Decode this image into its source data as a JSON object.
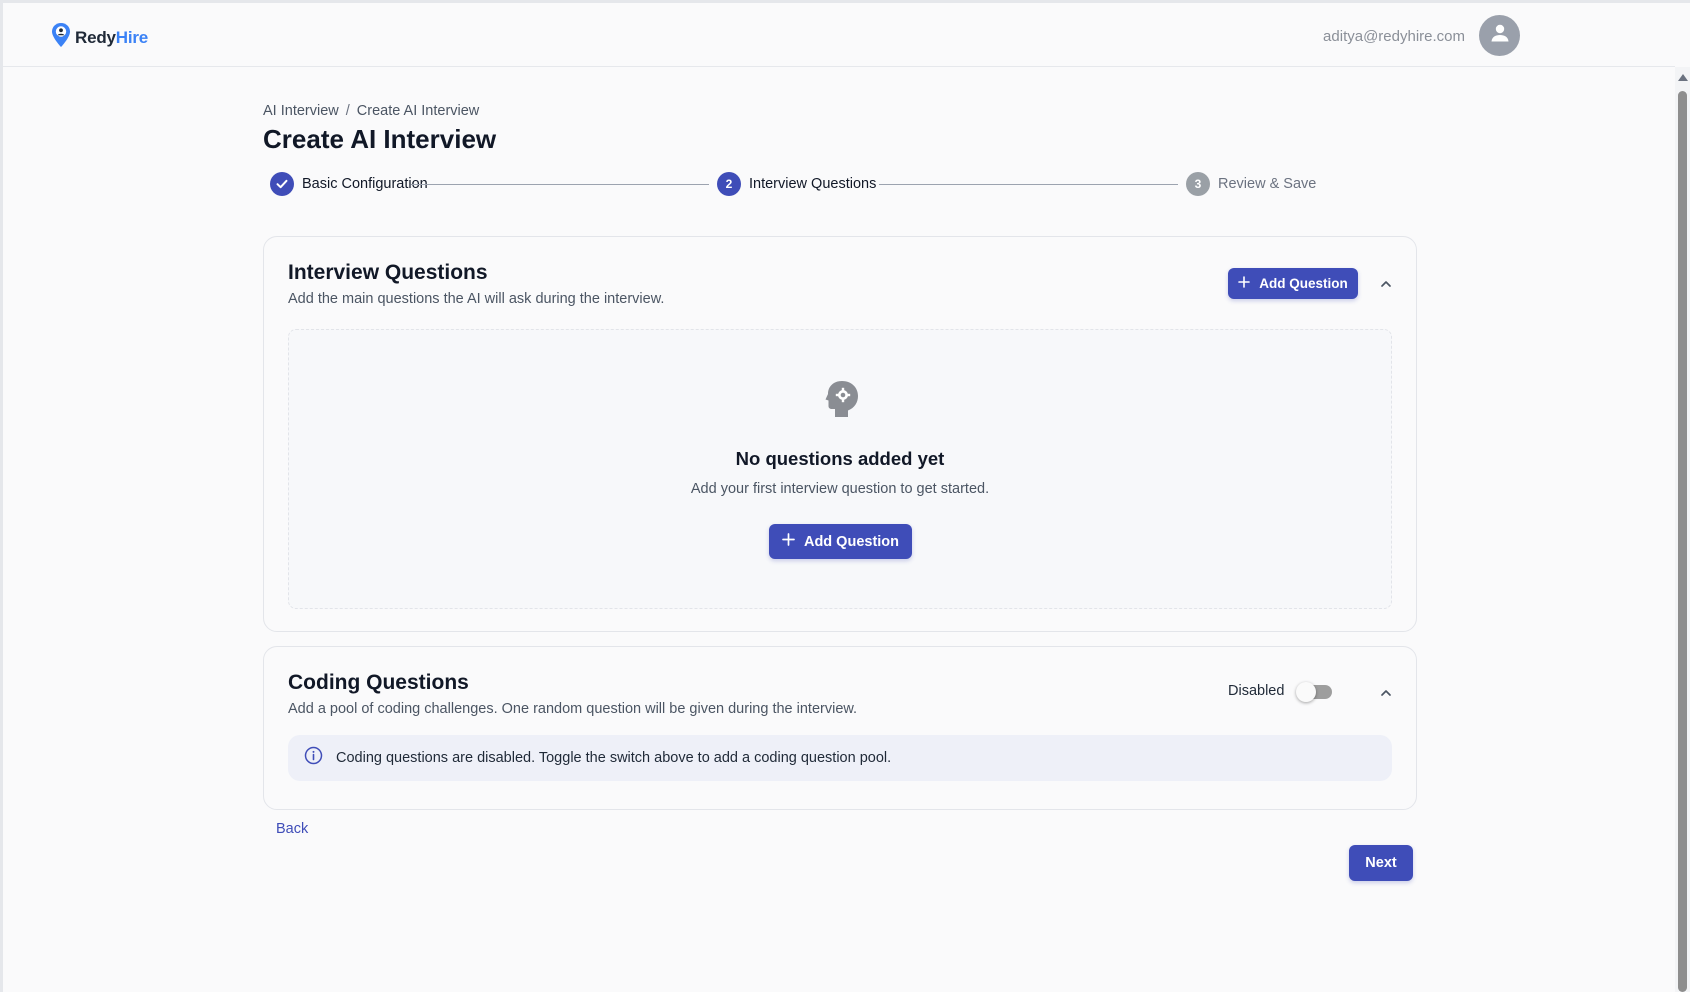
{
  "header": {
    "logo_part1": "Redy",
    "logo_part2": "Hire",
    "user_email": "aditya@redyhire.com"
  },
  "breadcrumb": {
    "items": [
      "AI Interview",
      "Create AI Interview"
    ],
    "separator": "/"
  },
  "page_title": "Create AI Interview",
  "stepper": {
    "steps": [
      {
        "label": "Basic Configuration",
        "state": "completed",
        "number": "1"
      },
      {
        "label": "Interview Questions",
        "state": "active",
        "number": "2"
      },
      {
        "label": "Review & Save",
        "state": "pending",
        "number": "3"
      }
    ]
  },
  "interview_section": {
    "title": "Interview Questions",
    "subtitle": "Add the main questions the AI will ask during the interview.",
    "add_button": "Add Question",
    "empty_title": "No questions added yet",
    "empty_subtitle": "Add your first interview question to get started.",
    "empty_button": "Add Question"
  },
  "coding_section": {
    "title": "Coding Questions",
    "subtitle": "Add a pool of coding challenges. One random question will be given during the interview.",
    "toggle_label": "Disabled",
    "toggle_on": false,
    "info_text": "Coding questions are disabled. Toggle the switch above to add a coding question pool."
  },
  "footer": {
    "back_label": "Back",
    "next_label": "Next"
  },
  "colors": {
    "primary": "#3f4db8",
    "logo_blue": "#3b82f6",
    "background": "#fafafb",
    "muted_text": "#8a8f98"
  }
}
